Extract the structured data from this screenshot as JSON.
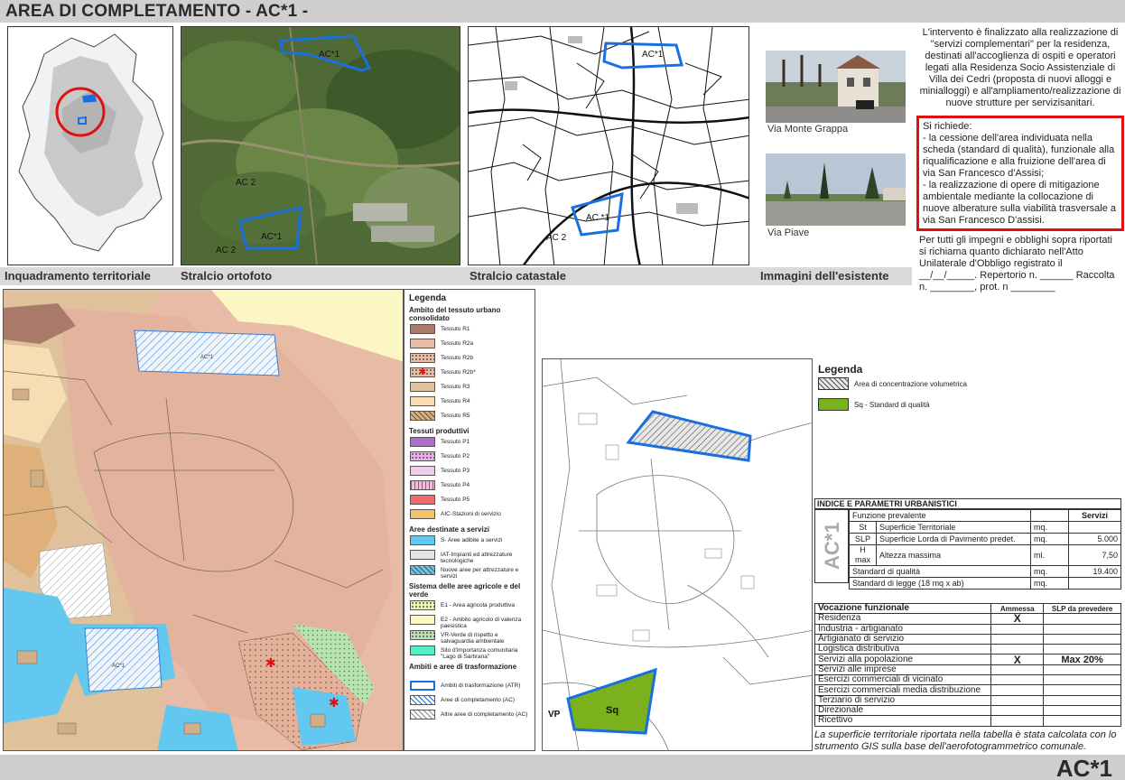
{
  "header": {
    "title": "AREA DI COMPLETAMENTO - AC*1 -"
  },
  "footer": {
    "code": "AC*1"
  },
  "strip_labels": {
    "inquadramento": "Inquadramento territoriale",
    "ortofoto": "Stralcio ortofoto",
    "catastale": "Stralcio catastale",
    "immagini": "Immagini dell'esistente"
  },
  "map_labels": {
    "ac1": "AC*1",
    "ac1_alt": "AC *1",
    "ac2": "AC 2",
    "ac_ortho": "AC 2",
    "sq": "Sq",
    "vp": "VP",
    "ac_small": "AC*1"
  },
  "photos": {
    "photo1_caption": "Via Monte Grappa",
    "photo2_caption": "Via Piave"
  },
  "intro_text": "L'intervento è finalizzato alla realizzazione di \"servizi complementari\" per la residenza, destinati all'accoglienza di ospiti e operatori legati alla Residenza Socio Assistenziale di Villa dei Cedri (proposta di nuovi alloggi e minialloggi) e all'ampliamento/realizzazione di nuove strutture per servizisanitari.",
  "requirements": {
    "lead": "Si richiede:",
    "items": [
      "- la cessione dell'area individuata nella scheda (standard di qualità), funzionale alla riqualificazione e alla fruizione dell'area di via San Francesco d'Assisi;",
      "- la realizzazione di opere di mitigazione ambientale mediante la collocazione di nuove alberature sulla viabilità trasversale a via San Francesco D'assisi."
    ]
  },
  "obligation_text": "Per tutti gli impegni e obblighi sopra riportati si richiama quanto dichiarato nell'Atto Unilaterale d'Obbligo registrato il __/__/_____. Repertorio n. ______ Raccolta n. ________, prot. n ________",
  "plan_legend": {
    "title": "Legenda",
    "sections": [
      {
        "heading": "Ambito del tessuto urbano consolidato",
        "items": [
          {
            "label": "Tessuto R1",
            "color": "#a9796a",
            "pattern": "solid"
          },
          {
            "label": "Tessuto R2a",
            "color": "#e8bba6",
            "pattern": "solid"
          },
          {
            "label": "Tessuto R2b",
            "color": "#e8bba6",
            "pattern": "dots"
          },
          {
            "label": "Tessuto R2b*",
            "color": "#e8bba6",
            "pattern": "star"
          },
          {
            "label": "Tessuto R3",
            "color": "#dfc29b",
            "pattern": "solid"
          },
          {
            "label": "Tessuto R4",
            "color": "#f6ddb3",
            "pattern": "solid"
          },
          {
            "label": "Tessuto R5",
            "color": "#e0b07a",
            "pattern": "hatch"
          }
        ]
      },
      {
        "heading": "Tessuti produttivi",
        "items": [
          {
            "label": "Tessuto P1",
            "color": "#b06ccc",
            "pattern": "solid"
          },
          {
            "label": "Tessuto P2",
            "color": "#e9aee9",
            "pattern": "dots"
          },
          {
            "label": "Tessuto P3",
            "color": "#f1ccef",
            "pattern": "solid"
          },
          {
            "label": "Tessuto P4",
            "color": "#f2b9d9",
            "pattern": "vlines"
          },
          {
            "label": "Tessuto P5",
            "color": "#f06a6a",
            "pattern": "solid"
          },
          {
            "label": "AIC-Stazioni di servizio",
            "color": "#f4c06a",
            "pattern": "solid"
          }
        ]
      },
      {
        "heading": "Aree destinate a servizi",
        "items": [
          {
            "label": "S- Aree adibite a servizi",
            "color": "#62c8ef",
            "pattern": "solid"
          },
          {
            "label": "IAT-Impianti ed attrezzature tecnologiche",
            "color": "#e4e4e4",
            "pattern": "solid"
          },
          {
            "label": "Nuove aree per attrezzature e servizi",
            "color": "#62c8ef",
            "pattern": "hatch"
          }
        ]
      },
      {
        "heading": "Sistema delle aree agricole e del verde",
        "items": [
          {
            "label": "E1 - Area agricola produttiva",
            "color": "#eaf4b4",
            "pattern": "dots"
          },
          {
            "label": "E2 - Ambito agricolo di valenza paesistica",
            "color": "#fbf6c2",
            "pattern": "solid"
          },
          {
            "label": "VR-Verde di rispetto e salvaguardia ambientale",
            "color": "#b9e2b0",
            "pattern": "dots"
          },
          {
            "label": "Sito d'importanza comunitaria \"Lago di Sartirana\"",
            "color": "#52efc6",
            "pattern": "solid"
          }
        ]
      },
      {
        "heading": "Ambiti e aree di trasformazione",
        "items": [
          {
            "label": "Ambiti di trasformazione (ATR)",
            "color": "#ffffff",
            "pattern": "blueborder"
          },
          {
            "label": "Aree di completamento (AC)",
            "color": "#ffffff",
            "pattern": "bluehatch"
          },
          {
            "label": "Altre aree di completamento (AC)",
            "color": "#ffffff",
            "pattern": "grayhatch"
          }
        ]
      }
    ]
  },
  "site_legend": {
    "title": "Legenda",
    "items": [
      {
        "label": "Area di concentrazione volumetrica",
        "pattern": "hatch"
      },
      {
        "label": "Sq - Standard di qualità",
        "color": "#7ab11d"
      }
    ]
  },
  "index_table": {
    "title": "INDICE E PARAMETRI URBANISTICI",
    "side_label": "AC*1",
    "header": {
      "label": "Funzione prevalente",
      "value": "Servizi"
    },
    "rows": [
      {
        "code": "St",
        "label": "Superficie Territoriale",
        "unit": "mq.",
        "value": ""
      },
      {
        "code": "SLP",
        "label": "Superficie Lorda di Pavimento predet.",
        "unit": "mq.",
        "value": "5.000"
      },
      {
        "code": "H max",
        "label": "Altezza massima",
        "unit": "ml.",
        "value": "7,50"
      }
    ],
    "rows2": [
      {
        "label": "Standard di qualità",
        "unit": "mq.",
        "value": "19.400"
      },
      {
        "label": "Standard di legge (18 mq x ab)",
        "unit": "mq.",
        "value": ""
      }
    ]
  },
  "vocation_table": {
    "headers": [
      "Vocazione funzionale",
      "Ammessa",
      "SLP da prevedere"
    ],
    "rows": [
      {
        "label": "Residenza",
        "ammessa": "X",
        "slp": ""
      },
      {
        "label": "Industria - artigianato",
        "ammessa": "",
        "slp": ""
      },
      {
        "label": "Artigianato di servizio",
        "ammessa": "",
        "slp": ""
      },
      {
        "label": "Logistica distributiva",
        "ammessa": "",
        "slp": ""
      },
      {
        "label": "Servizi alla popolazione",
        "ammessa": "X",
        "slp": "Max 20%"
      },
      {
        "label": "Servizi alle imprese",
        "ammessa": "",
        "slp": ""
      },
      {
        "label": "Esercizi commerciali di vicinato",
        "ammessa": "",
        "slp": ""
      },
      {
        "label": "Esercizi commerciali media distribuzione",
        "ammessa": "",
        "slp": ""
      },
      {
        "label": "Terziario di servizio",
        "ammessa": "",
        "slp": ""
      },
      {
        "label": "Direzionale",
        "ammessa": "",
        "slp": ""
      },
      {
        "label": "Ricettivo",
        "ammessa": "",
        "slp": ""
      }
    ]
  },
  "note_text": "La superficie territoriale riportata nella tabella è stata calcolata con lo strumento GIS sulla base dell'aerofotogrammetrico comunale.",
  "colors": {
    "boundary_blue": "#1a6fe0",
    "highlight_red": "#e01010",
    "standard_green": "#7ab11d"
  }
}
